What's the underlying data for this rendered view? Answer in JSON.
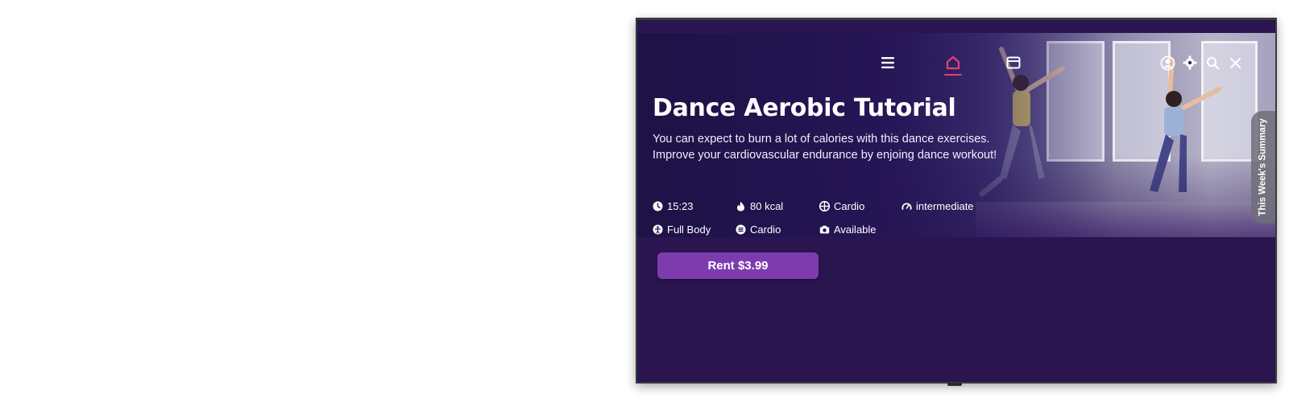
{
  "nav": {
    "icons": [
      "menu-icon",
      "home-icon",
      "calendar-icon",
      "profile-icon",
      "settings-icon",
      "search-icon",
      "close-icon"
    ],
    "active": "home-icon",
    "accent_color": "#e0436f"
  },
  "content": {
    "title": "Dance Aerobic Tutorial",
    "description_line1": "You can expect to burn a lot of calories with this dance exercises.",
    "description_line2": "Improve your cardiovascular endurance by enjoing dance workout!",
    "meta": {
      "duration": "15:23",
      "calories": "80 kcal",
      "category": "Cardio",
      "level": "intermediate",
      "target": "Full Body",
      "type": "Cardio",
      "camera": "Available"
    }
  },
  "actions": {
    "rent_label": "Rent $3.99",
    "button_color": "#7d3cae"
  },
  "side_tab": {
    "label": "This Week's Summary"
  },
  "theme": {
    "background": "#2a1550"
  }
}
